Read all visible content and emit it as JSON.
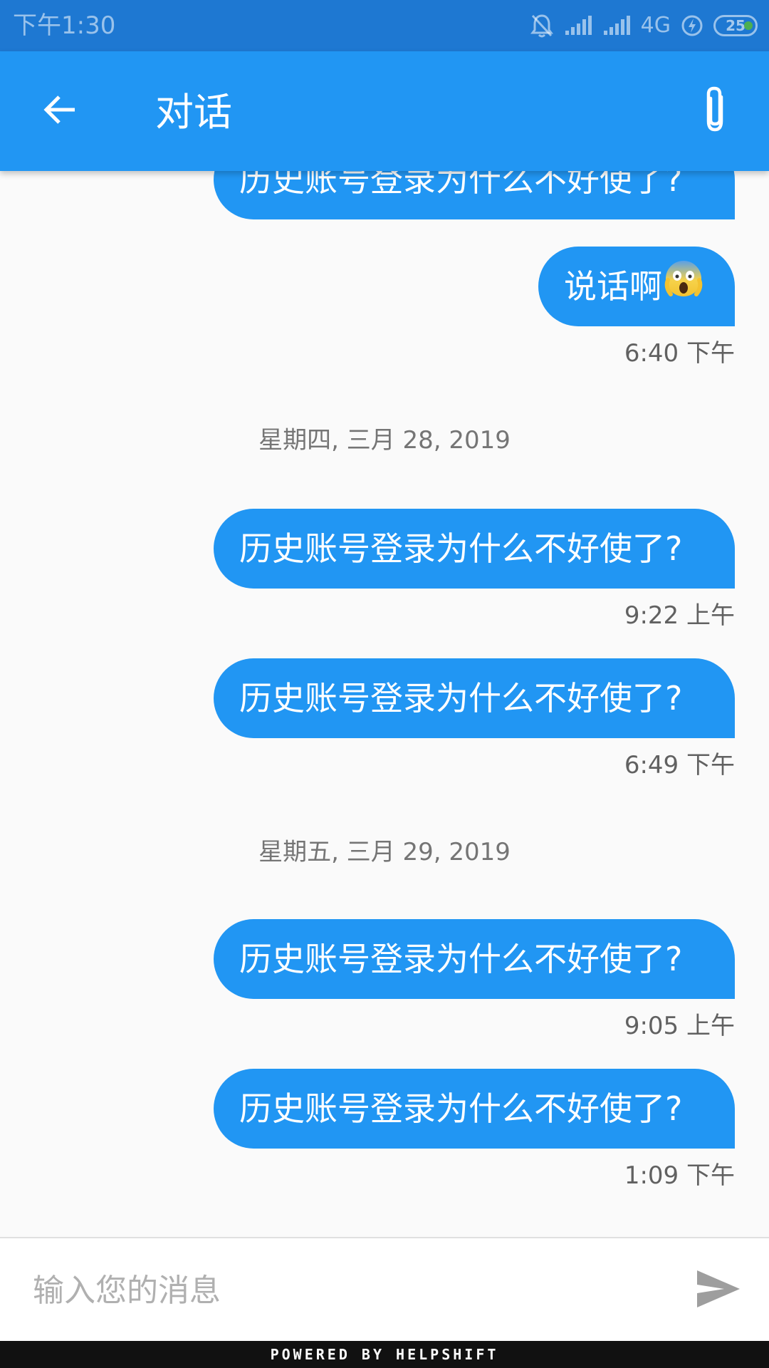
{
  "status_bar": {
    "time": "下午1:30",
    "network": "4G",
    "battery": "25"
  },
  "app_bar": {
    "title": "对话",
    "back_icon": "arrow-back-icon",
    "attach_icon": "paperclip-icon"
  },
  "messages": [
    {
      "text": "历史账号登录为什么不好使了?",
      "sender": "user"
    },
    {
      "text": "说话啊",
      "emoji": "face-screaming-in-fear",
      "sender": "user"
    },
    {
      "time": "6:40 下午"
    },
    {
      "date": "星期四, 三月 28, 2019"
    },
    {
      "text": "历史账号登录为什么不好使了?",
      "sender": "user"
    },
    {
      "time": "9:22 上午"
    },
    {
      "text": "历史账号登录为什么不好使了?",
      "sender": "user"
    },
    {
      "time": "6:49 下午"
    },
    {
      "date": "星期五, 三月 29, 2019"
    },
    {
      "text": "历史账号登录为什么不好使了?",
      "sender": "user"
    },
    {
      "time": "9:05 上午"
    },
    {
      "text": "历史账号登录为什么不好使了?",
      "sender": "user"
    },
    {
      "time": "1:09 下午"
    }
  ],
  "composer": {
    "placeholder": "输入您的消息",
    "value": "",
    "send_icon": "send-icon"
  },
  "footer": {
    "text": "POWERED BY HELPSHIFT"
  },
  "colors": {
    "status_bar": "#1e78d2",
    "app_bar": "#2196f3",
    "bubble": "#2196f3",
    "background": "#fafafa"
  }
}
